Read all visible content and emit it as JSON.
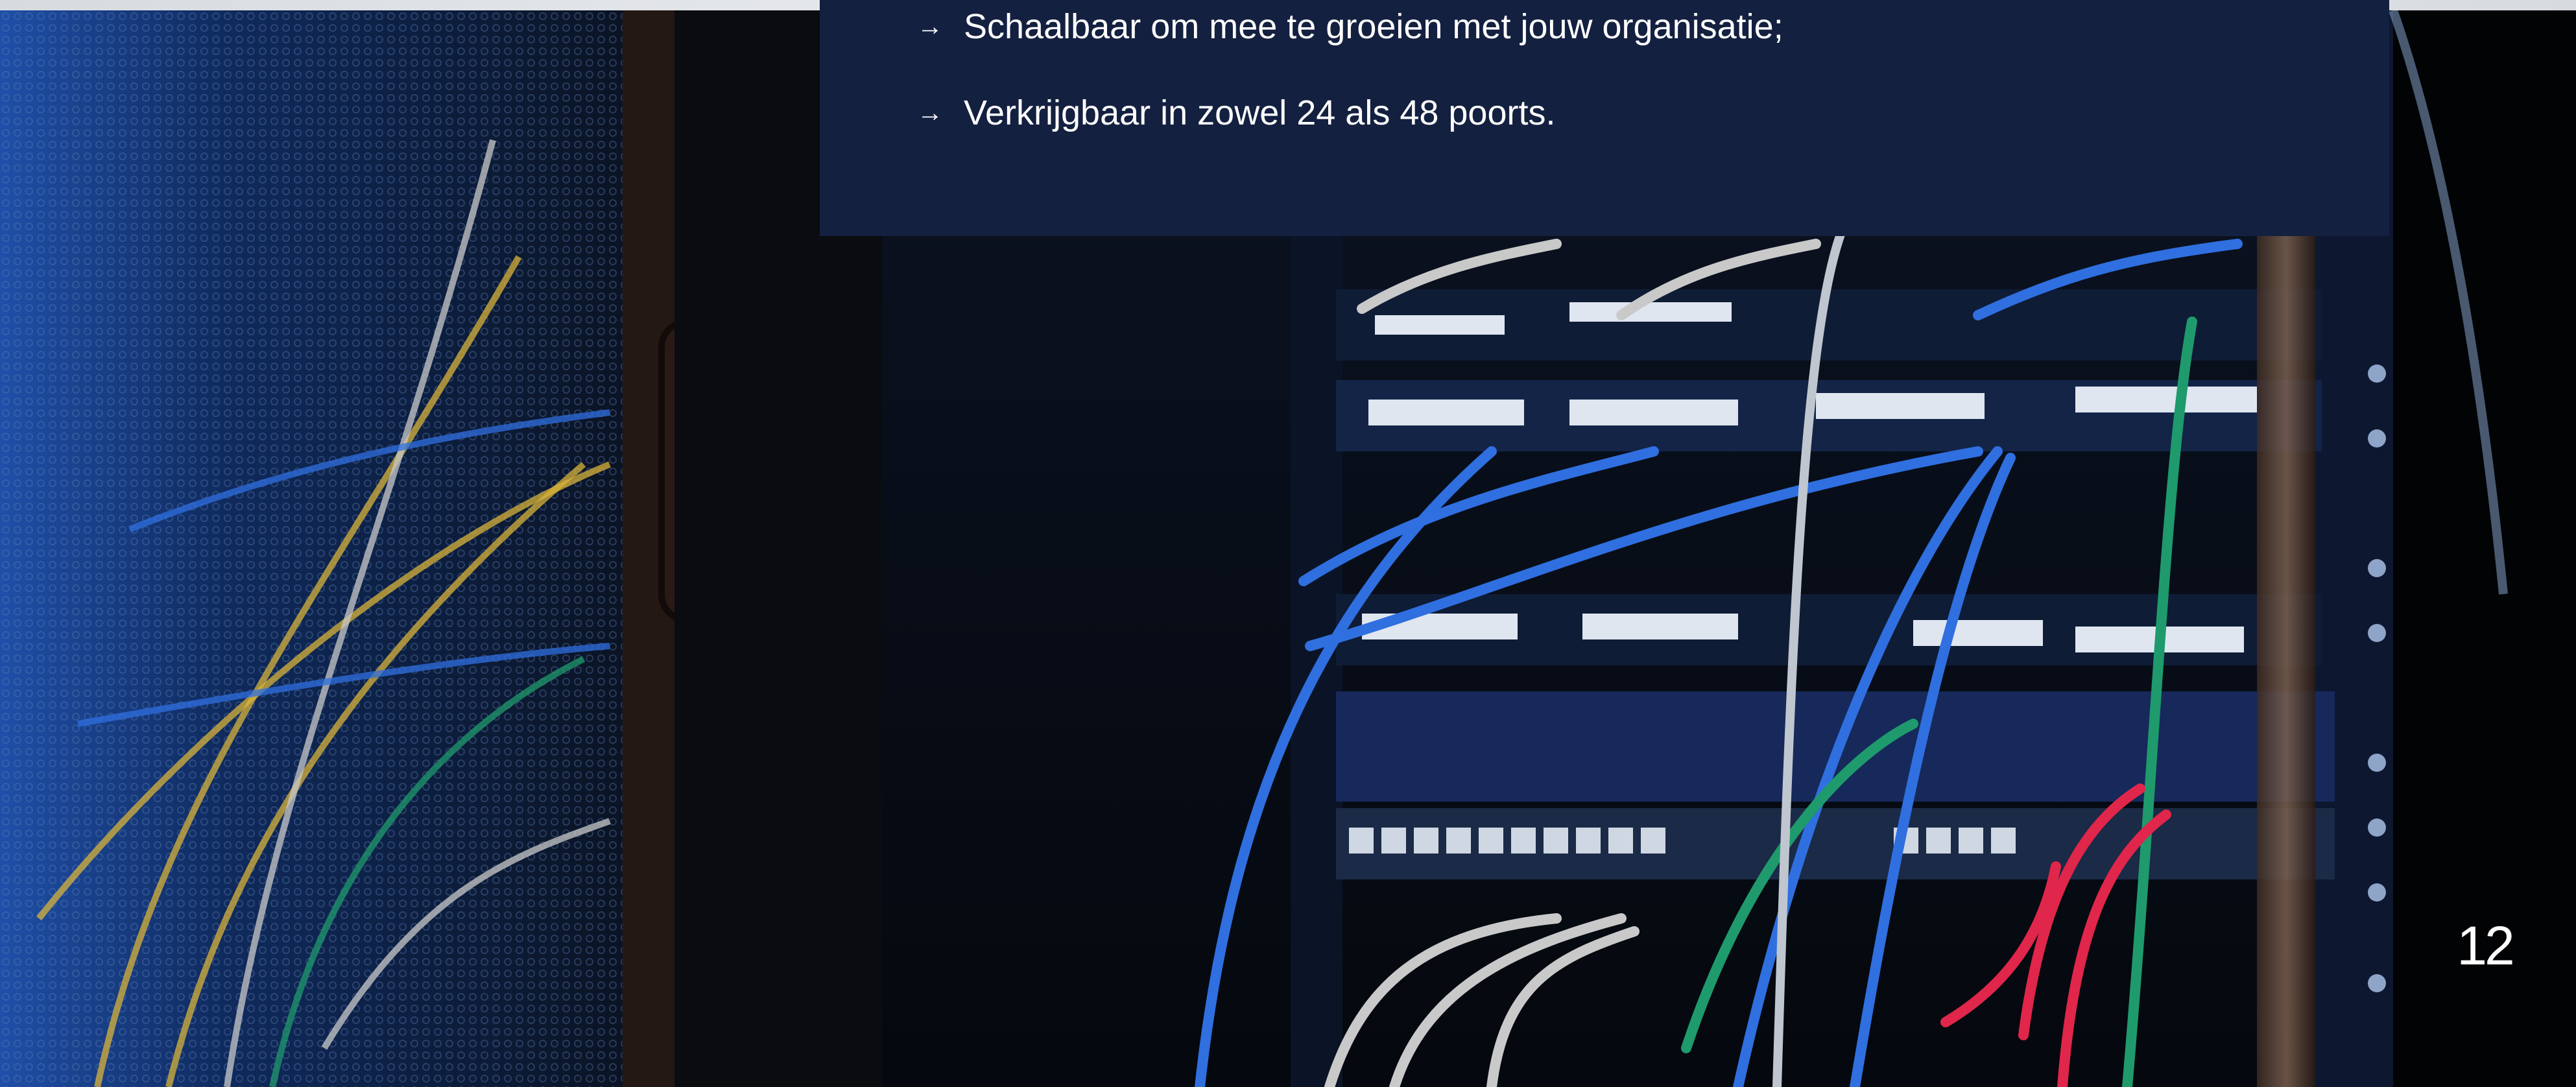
{
  "bullets": [
    {
      "icon": "arrow-right-icon",
      "text": "Schaalbaar om mee te groeien met jouw organisatie;"
    },
    {
      "icon": "arrow-right-icon",
      "text": "Verkrijgbaar in zowel 24 als 48 poorts."
    }
  ],
  "page_number": "12",
  "colors": {
    "panel_background": "#142040",
    "text": "#ffffff",
    "cable_blue": "#2f6fe0",
    "cable_yellow": "#d8b33a",
    "cable_green": "#1f9a6c",
    "cable_red": "#e0264a"
  }
}
